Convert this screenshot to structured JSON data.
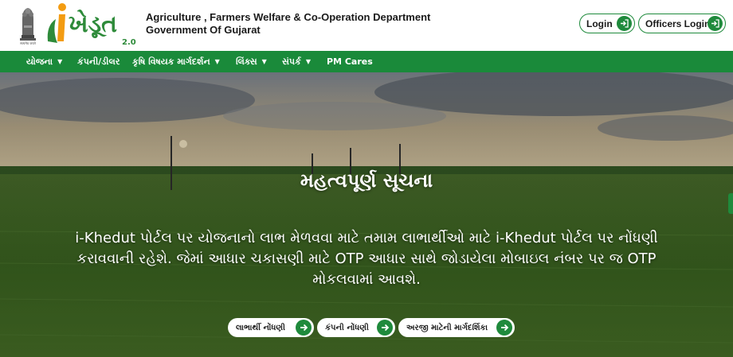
{
  "header": {
    "logo_text": "ખેડૂત",
    "logo_version": "2.0",
    "department_line1": "Agriculture , Farmers Welfare & Co-Operation Department",
    "department_line2": "Government Of Gujarat",
    "login_label": "Login",
    "officers_login_label": "Officers Login"
  },
  "nav": {
    "items": [
      {
        "label": "યોજના",
        "has_dropdown": true
      },
      {
        "label": "કંપની/ડીલર",
        "has_dropdown": false
      },
      {
        "label": "કૃષિ વિષયક માર્ગદર્શન",
        "has_dropdown": true
      },
      {
        "label": "લિંક્સ",
        "has_dropdown": true
      },
      {
        "label": "સંપર્ક",
        "has_dropdown": true
      },
      {
        "label": "PM Cares",
        "has_dropdown": false
      }
    ]
  },
  "hero": {
    "title": "મહત્વપૂર્ણ સૂચના",
    "notice_line1": "i-Khedut પોર્ટલ પર યોજનાનો લાભ મેળવવા માટે તમામ લાભાર્થીઓ માટે i-Khedut પોર્ટલ પર નોંધણી",
    "notice_line2": "કરાવવાની રહેશે. જેમાં આધાર ચકાસણી માટે OTP આધાર સાથે જોડાયેલા મોબાઇલ નંબર પર જ OTP",
    "notice_line3": "મોકલવામાં આવશે.",
    "buttons": [
      {
        "label": "લાભાર્થી નોંધણી"
      },
      {
        "label": "કંપની નોંધણી"
      },
      {
        "label": "અરજી માટેની માર્ગદર્શિકા"
      }
    ]
  },
  "colors": {
    "brand_green": "#1a8a3a",
    "logo_orange": "#f39c12",
    "logo_green": "#2e8b3a"
  },
  "icons": {
    "login": "login-arrow-icon",
    "cta": "arrow-right-icon",
    "dropdown": "chevron-down-icon"
  }
}
